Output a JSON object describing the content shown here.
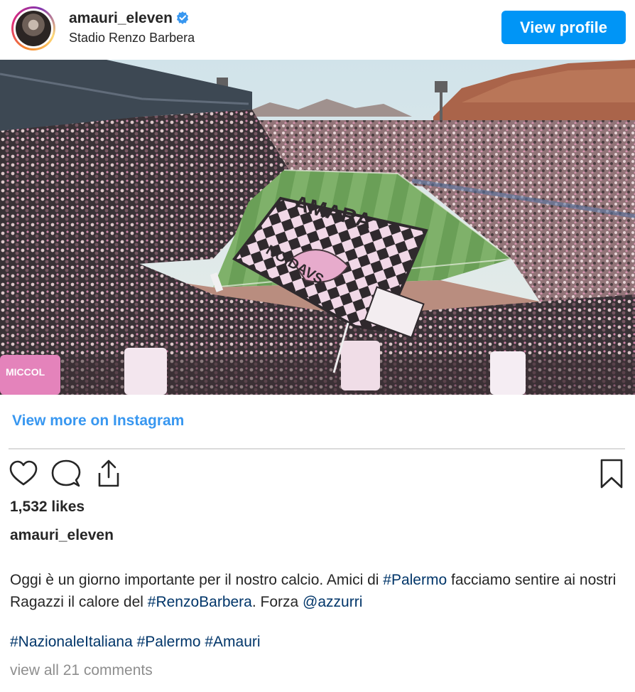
{
  "header": {
    "username": "amauri_eleven",
    "verified": true,
    "location": "Stadio Renzo Barbera",
    "view_profile_label": "View profile"
  },
  "photo": {
    "description_icon": "stadium-photo",
    "flag_text_top": "AMARA",
    "flag_text_bottom": "NOIDAVS",
    "shirt_text": "MICCOL"
  },
  "links": {
    "view_more": "View more on Instagram"
  },
  "actions": {
    "icons": [
      "heart-icon",
      "comment-icon",
      "share-icon",
      "bookmark-icon"
    ]
  },
  "post": {
    "likes": "1,532 likes",
    "caption_user": "amauri_eleven",
    "caption_parts": {
      "p1": "Oggi è un giorno importante per il nostro calcio. Amici di ",
      "tag1": "#Palermo",
      "p2": " facciamo sentire ai nostri Ragazzi il calore del ",
      "tag2": "#RenzoBarbera",
      "p3": ". Forza ",
      "tag3": "@azzurri"
    },
    "hashtags": "#NazionaleItaliana #Palermo #Amauri",
    "comments_link": "view all 21 comments"
  },
  "colors": {
    "accent_blue": "#0095f6",
    "link_blue": "#3897f0",
    "tag_blue": "#003569",
    "muted_grey": "#8e8e8e"
  }
}
